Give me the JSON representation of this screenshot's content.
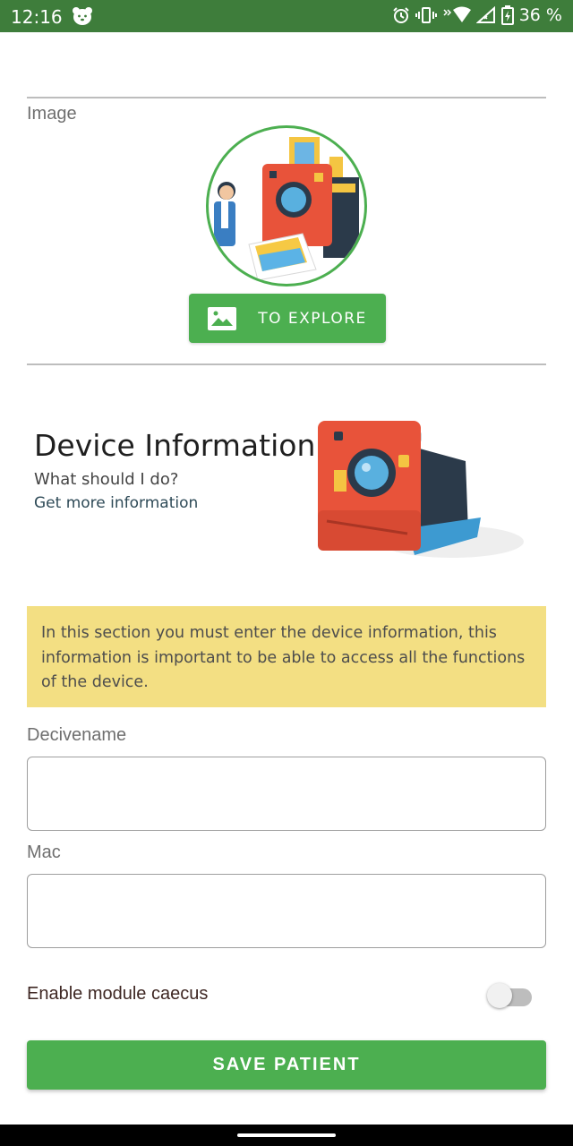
{
  "status_bar": {
    "time": "12:16",
    "battery_percent": "36 %",
    "icons": [
      "bear-app-icon",
      "alarm-icon",
      "vibrate-icon",
      "wifi-icon",
      "signal-icon",
      "battery-icon"
    ]
  },
  "image_section": {
    "label": "Image",
    "explore_button_label": "TO EXPLORE",
    "explore_icon": "image-icon"
  },
  "device_info": {
    "title": "Device Information",
    "subtitle": "What should I do?",
    "link": "Get more information",
    "notice": "In this section you must enter the device information, this information is important to be able to access all the functions of the device."
  },
  "form": {
    "device_name_label": "Decivename",
    "device_name_value": "",
    "mac_label": "Mac",
    "mac_value": "",
    "toggle_label": "Enable module caecus",
    "toggle_on": false,
    "save_label": "SAVE PATIENT"
  },
  "colors": {
    "status_bar": "#3e7d3b",
    "accent": "#4caf50",
    "notice_bg": "#f3df83"
  }
}
